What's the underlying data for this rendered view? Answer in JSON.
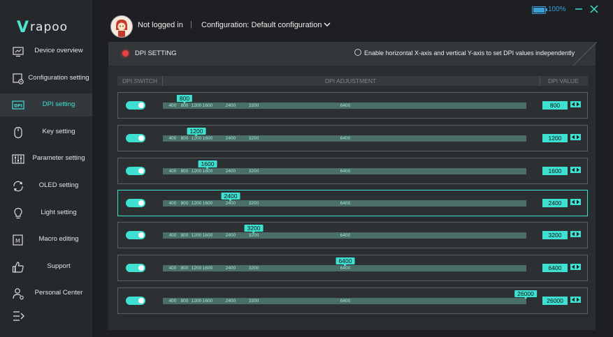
{
  "app": {
    "logo_text": "rapoo"
  },
  "battery": {
    "percent_label": "100%",
    "level": 1.0,
    "color": "#3aa0d8"
  },
  "header": {
    "login_status": "Not logged in",
    "separator": "|",
    "configuration": "Configuration: Default configuration"
  },
  "sidebar": {
    "items": [
      {
        "label": "Device overview",
        "icon": "monitor-icon"
      },
      {
        "label": "Configuration setting",
        "icon": "config-icon"
      },
      {
        "label": "DPI setting",
        "icon": "dpi-icon",
        "active": true
      },
      {
        "label": "Key setting",
        "icon": "mouse-icon"
      },
      {
        "label": "Parameter setting",
        "icon": "sliders-icon"
      },
      {
        "label": "OLED setting",
        "icon": "refresh-icon"
      },
      {
        "label": "Light setting",
        "icon": "bulb-icon"
      },
      {
        "label": "Macro editing",
        "icon": "macro-icon"
      },
      {
        "label": "Support",
        "icon": "thumbs-up-icon"
      },
      {
        "label": "Personal Center",
        "icon": "user-gear-icon"
      }
    ]
  },
  "dpi_panel": {
    "title": "DPI SETTING",
    "option_label": "Enable horizontal X-axis and vertical Y-axis to set DPI values independently",
    "columns": {
      "switch": "DPI SWITCH",
      "adjustment": "DPI ADJUSTMENT",
      "value": "DPI VALUE"
    },
    "tick_labels": [
      "400",
      "800",
      "1200",
      "1600",
      "2400",
      "3200",
      "6400"
    ],
    "rows": [
      {
        "enabled": true,
        "dpi": "800"
      },
      {
        "enabled": true,
        "dpi": "1200"
      },
      {
        "enabled": true,
        "dpi": "1600"
      },
      {
        "enabled": true,
        "dpi": "2400",
        "selected": true
      },
      {
        "enabled": true,
        "dpi": "3200"
      },
      {
        "enabled": true,
        "dpi": "6400"
      },
      {
        "enabled": true,
        "dpi": "26000"
      }
    ]
  },
  "colors": {
    "accent": "#3ee0d2",
    "status_dot": "#e84141",
    "panel": "#2a2d30"
  }
}
